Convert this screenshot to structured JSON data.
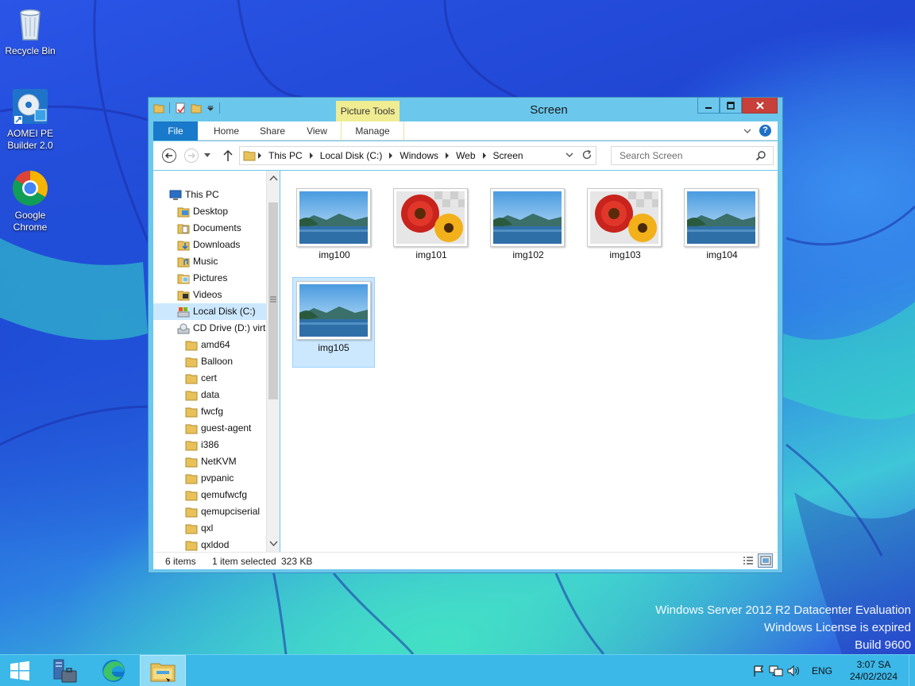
{
  "desktop": {
    "icons": [
      {
        "label": "Recycle Bin",
        "icon": "recycle-bin-icon"
      },
      {
        "label": "AOMEI PE Builder 2.0",
        "icon": "aomei-pe-builder-icon"
      },
      {
        "label": "Google Chrome",
        "icon": "chrome-icon"
      }
    ],
    "watermark": {
      "line1": "Windows Server 2012 R2 Datacenter Evaluation",
      "line2": "Windows License is expired",
      "line3": "Build 9600"
    }
  },
  "window": {
    "title": "Screen",
    "contextual_tab_group": "Picture Tools",
    "controls": {
      "minimize": "minimize-icon",
      "maximize": "maximize-icon",
      "close": "close-icon"
    },
    "ribbon_tabs": [
      "File",
      "Home",
      "Share",
      "View",
      "Manage"
    ],
    "address": {
      "crumbs": [
        "This PC",
        "Local Disk (C:)",
        "Windows",
        "Web",
        "Screen"
      ]
    },
    "search": {
      "placeholder": "Search Screen"
    },
    "nav_tree": [
      {
        "label": "This PC",
        "icon": "pc-icon"
      },
      {
        "label": "Desktop",
        "icon": "desktop-folder-icon"
      },
      {
        "label": "Documents",
        "icon": "documents-folder-icon"
      },
      {
        "label": "Downloads",
        "icon": "downloads-folder-icon"
      },
      {
        "label": "Music",
        "icon": "music-folder-icon"
      },
      {
        "label": "Pictures",
        "icon": "pictures-folder-icon"
      },
      {
        "label": "Videos",
        "icon": "videos-folder-icon"
      },
      {
        "label": "Local Disk (C:)",
        "icon": "drive-icon",
        "selected": true
      },
      {
        "label": "CD Drive (D:) virtio-win",
        "icon": "cd-drive-icon"
      },
      {
        "label": "amd64",
        "icon": "folder-icon"
      },
      {
        "label": "Balloon",
        "icon": "folder-icon"
      },
      {
        "label": "cert",
        "icon": "folder-icon"
      },
      {
        "label": "data",
        "icon": "folder-icon"
      },
      {
        "label": "fwcfg",
        "icon": "folder-icon"
      },
      {
        "label": "guest-agent",
        "icon": "folder-icon"
      },
      {
        "label": "i386",
        "icon": "folder-icon"
      },
      {
        "label": "NetKVM",
        "icon": "folder-icon"
      },
      {
        "label": "pvpanic",
        "icon": "folder-icon"
      },
      {
        "label": "qemufwcfg",
        "icon": "folder-icon"
      },
      {
        "label": "qemupciserial",
        "icon": "folder-icon"
      },
      {
        "label": "qxl",
        "icon": "folder-icon"
      },
      {
        "label": "qxldod",
        "icon": "folder-icon"
      }
    ],
    "files": [
      {
        "name": "img100",
        "thumb": "landscape"
      },
      {
        "name": "img101",
        "thumb": "flowers"
      },
      {
        "name": "img102",
        "thumb": "landscape"
      },
      {
        "name": "img103",
        "thumb": "flowers"
      },
      {
        "name": "img104",
        "thumb": "landscape"
      },
      {
        "name": "img105",
        "thumb": "landscape",
        "selected": true
      }
    ],
    "status": {
      "item_count": "6 items",
      "selection": "1 item selected",
      "size": "323 KB"
    }
  },
  "taskbar": {
    "buttons": [
      "start-icon",
      "server-manager-icon",
      "edge-icon",
      "file-explorer-icon"
    ],
    "tray": {
      "language": "ENG",
      "time": "3:07 SA",
      "date": "24/02/2024"
    }
  },
  "colors": {
    "taskbar": "#3bb7e8",
    "window_frame": "#6cc7ec",
    "file_tab": "#1979ca",
    "selection": "#cce8ff",
    "picture_tools": "#f0ec92",
    "close_button": "#c7403a"
  }
}
